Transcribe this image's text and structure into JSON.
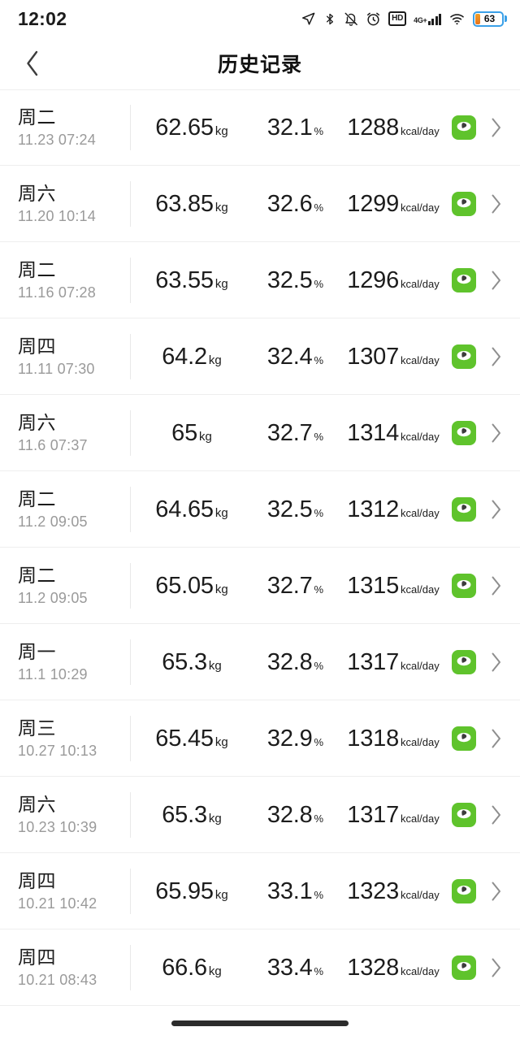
{
  "status_bar": {
    "time": "12:02",
    "battery_percent": "63",
    "network_label": "4G+",
    "hd_label": "HD",
    "icons": [
      "location-icon",
      "bluetooth-icon",
      "mute-bell-icon",
      "alarm-clock-icon",
      "hd-icon",
      "signal-icon",
      "wifi-icon",
      "battery-icon"
    ]
  },
  "app_bar": {
    "back_label": "‹",
    "title": "历史记录"
  },
  "units": {
    "weight": "kg",
    "fat": "%",
    "kcal": "kcal/day"
  },
  "accent_color": "#5fc32c",
  "rows": [
    {
      "weekday": "周二",
      "datetime": "11.23 07:24",
      "weight": "62.65",
      "fat": "32.1",
      "kcal": "1288"
    },
    {
      "weekday": "周六",
      "datetime": "11.20 10:14",
      "weight": "63.85",
      "fat": "32.6",
      "kcal": "1299"
    },
    {
      "weekday": "周二",
      "datetime": "11.16 07:28",
      "weight": "63.55",
      "fat": "32.5",
      "kcal": "1296"
    },
    {
      "weekday": "周四",
      "datetime": "11.11 07:30",
      "weight": "64.2",
      "fat": "32.4",
      "kcal": "1307"
    },
    {
      "weekday": "周六",
      "datetime": "11.6 07:37",
      "weight": "65",
      "fat": "32.7",
      "kcal": "1314"
    },
    {
      "weekday": "周二",
      "datetime": "11.2 09:05",
      "weight": "64.65",
      "fat": "32.5",
      "kcal": "1312"
    },
    {
      "weekday": "周二",
      "datetime": "11.2 09:05",
      "weight": "65.05",
      "fat": "32.7",
      "kcal": "1315"
    },
    {
      "weekday": "周一",
      "datetime": "11.1 10:29",
      "weight": "65.3",
      "fat": "32.8",
      "kcal": "1317"
    },
    {
      "weekday": "周三",
      "datetime": "10.27 10:13",
      "weight": "65.45",
      "fat": "32.9",
      "kcal": "1318"
    },
    {
      "weekday": "周六",
      "datetime": "10.23 10:39",
      "weight": "65.3",
      "fat": "32.8",
      "kcal": "1317"
    },
    {
      "weekday": "周四",
      "datetime": "10.21 10:42",
      "weight": "65.95",
      "fat": "33.1",
      "kcal": "1323"
    },
    {
      "weekday": "周四",
      "datetime": "10.21 08:43",
      "weight": "66.6",
      "fat": "33.4",
      "kcal": "1328"
    }
  ]
}
